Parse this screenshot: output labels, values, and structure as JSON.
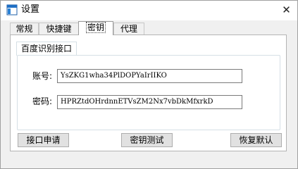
{
  "window": {
    "title": "设置",
    "icon": "app-window-icon",
    "close_glyph": "✕"
  },
  "tabs": [
    {
      "label": "常规",
      "selected": false
    },
    {
      "label": "快捷键",
      "selected": false
    },
    {
      "label": "密钥",
      "selected": true
    },
    {
      "label": "代理",
      "selected": false
    }
  ],
  "group": {
    "label": "百度识别接口",
    "account_label": "账号:",
    "account_value": "YsZKG1wha34PlDOPYaIrIIKO",
    "secret_label": "密码:",
    "secret_value": "HPRZtdOHrdnnETVsZM2Nx7vbDkMfxrkD"
  },
  "buttons": {
    "apply": "接口申请",
    "test": "密钥测试",
    "reset": "恢复默认"
  }
}
